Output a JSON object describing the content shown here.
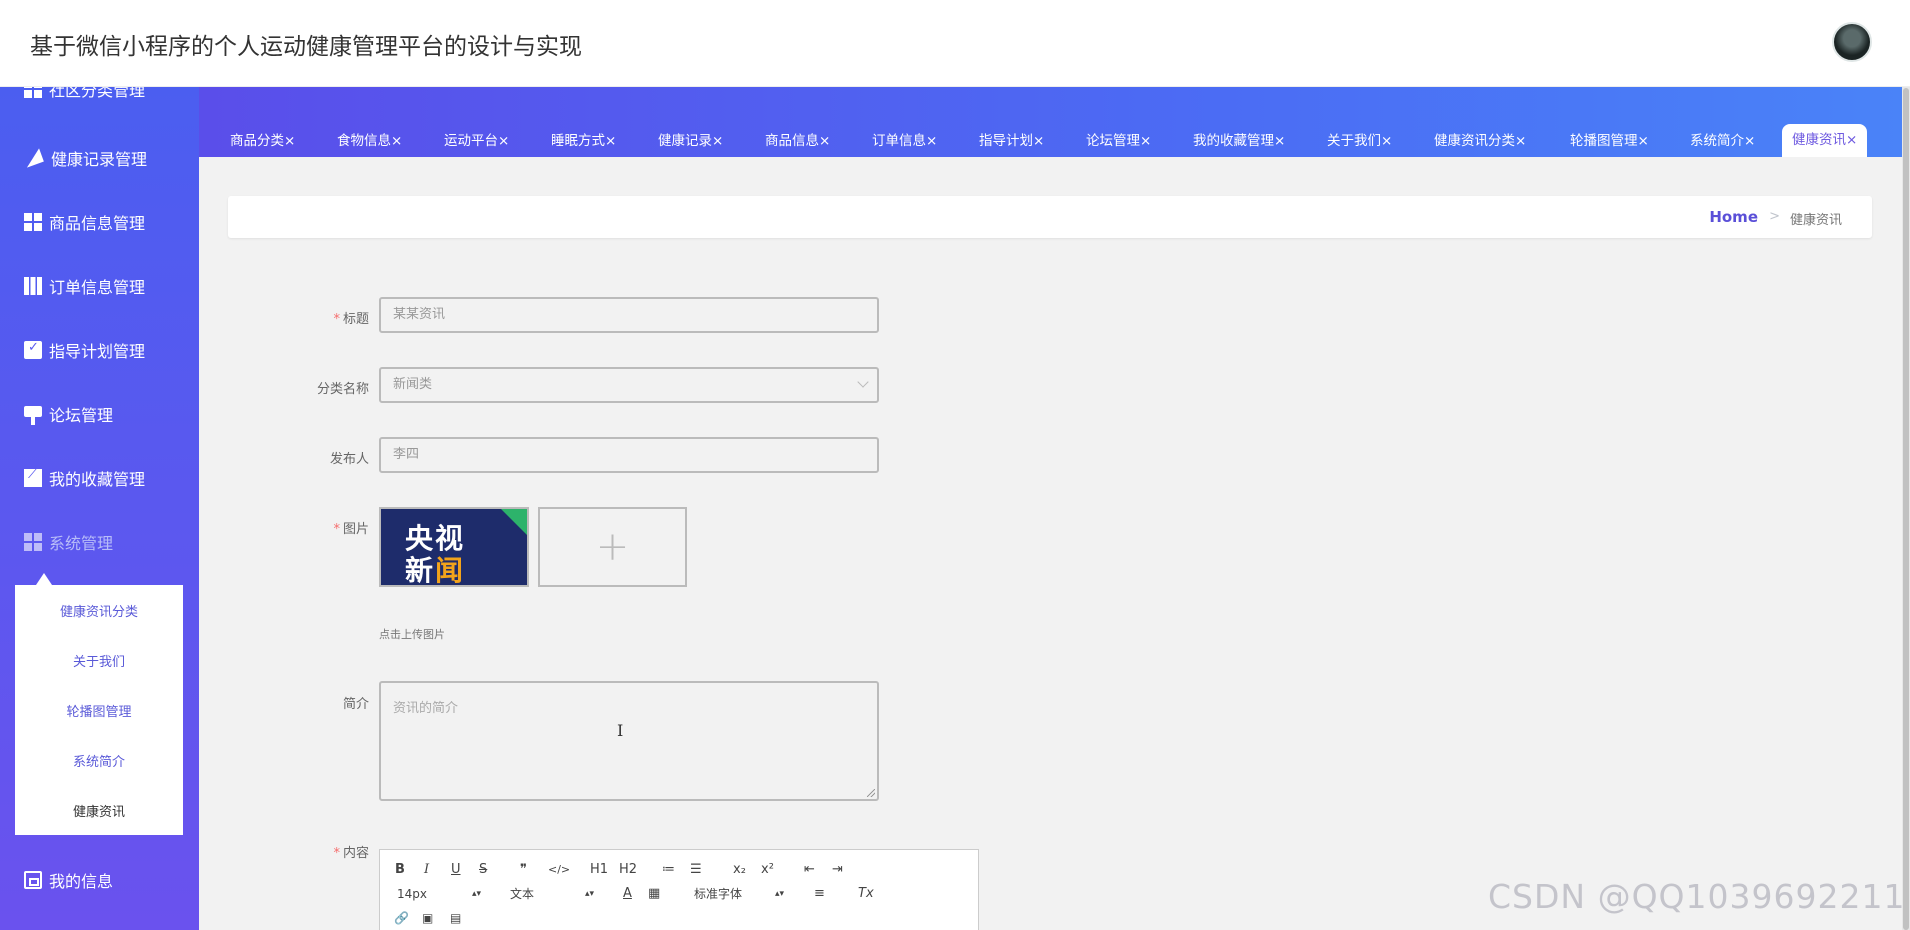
{
  "app": {
    "title": "基于微信小程序的个人运动健康管理平台的设计与实现"
  },
  "sidebar": {
    "cut_item": "社区分类管理",
    "items": [
      {
        "label": "健康记录管理",
        "icon": "paper-plane-icon"
      },
      {
        "label": "商品信息管理",
        "icon": "grid-icon"
      },
      {
        "label": "订单信息管理",
        "icon": "grid-nine-icon"
      },
      {
        "label": "指导计划管理",
        "icon": "clipboard-check-icon"
      },
      {
        "label": "论坛管理",
        "icon": "paint-brush-icon"
      },
      {
        "label": "我的收藏管理",
        "icon": "line-chart-icon"
      },
      {
        "label": "系统管理",
        "icon": "grid-icon"
      },
      {
        "label": "我的信息",
        "icon": "wallet-icon"
      }
    ],
    "submenu": [
      "健康资讯分类",
      "关于我们",
      "轮播图管理",
      "系统简介",
      "健康资讯"
    ]
  },
  "tabs": [
    "商品分类×",
    "食物信息×",
    "运动平台×",
    "睡眠方式×",
    "健康记录×",
    "商品信息×",
    "订单信息×",
    "指导计划×",
    "论坛管理×",
    "我的收藏管理×",
    "关于我们×",
    "健康资讯分类×",
    "轮播图管理×",
    "系统简介×",
    "健康资讯×"
  ],
  "breadcrumb": {
    "home": "Home",
    "separator": ">",
    "current": "健康资讯"
  },
  "form": {
    "title": {
      "label": "标题",
      "required": "*",
      "value": "某某资讯"
    },
    "category": {
      "label": "分类名称",
      "value": "新闻类"
    },
    "publisher": {
      "label": "发布人",
      "value": "李四"
    },
    "image": {
      "label": "图片",
      "required": "*",
      "hint": "点击上传图片",
      "add_symbol": "+",
      "thumb_line1": "央视",
      "thumb_line2a": "新",
      "thumb_line2b": "闻"
    },
    "summary": {
      "label": "简介",
      "placeholder": "资讯的简介"
    },
    "content": {
      "label": "内容",
      "required": "*"
    }
  },
  "editor": {
    "buttons": [
      "B",
      "I",
      "U",
      "S",
      "❞",
      "</>",
      "H1",
      "H2",
      "≔",
      "☰",
      "x₂",
      "x²",
      "⇤",
      "⇥"
    ],
    "font_size": "14px",
    "text_type": "文本",
    "font_family": "标准字体",
    "extra": [
      "A",
      "▦",
      "≡",
      "Tx"
    ],
    "row3": [
      "🔗",
      "▣",
      "▤"
    ]
  },
  "watermark": "CSDN @QQ1039692211"
}
